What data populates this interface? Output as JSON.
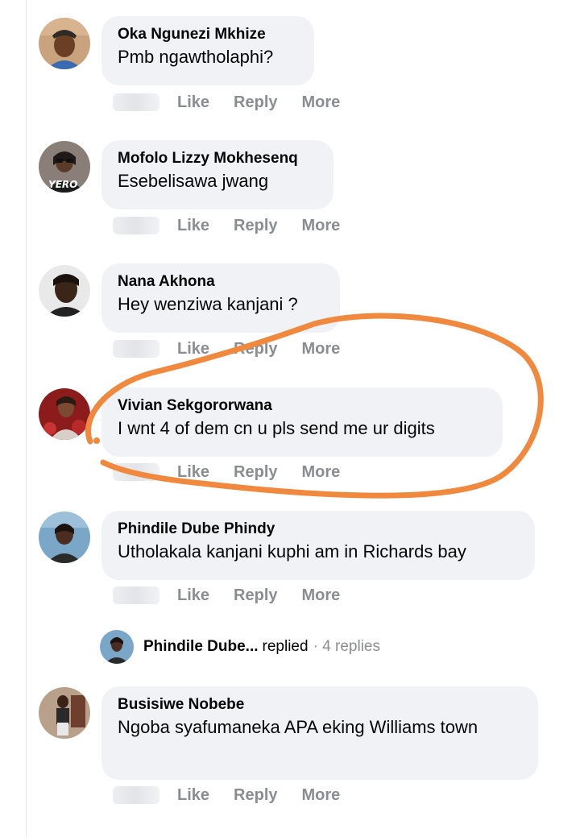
{
  "comments": [
    {
      "author": "Oka Ngunezi Mkhize",
      "text": "Pmb ngawtholaphi?",
      "actions": {
        "like": "Like",
        "reply": "Reply",
        "more": "More"
      }
    },
    {
      "author": "Mofolo Lizzy Mokhesenq",
      "text": "Esebelisawa jwang",
      "avatar_text": "YERO",
      "actions": {
        "like": "Like",
        "reply": "Reply",
        "more": "More"
      }
    },
    {
      "author": "Nana Akhona",
      "text": "Hey wenziwa kanjani ?",
      "actions": {
        "like": "Like",
        "reply": "Reply",
        "more": "More"
      }
    },
    {
      "author": "Vivian Sekgororwana",
      "text": "I wnt 4 of dem cn u pls send me ur digits",
      "actions": {
        "like": "Like",
        "reply": "Reply",
        "more": "More"
      }
    },
    {
      "author": "Phindile Dube Phindy",
      "text": "Utholakala kanjani kuphi am in Richards bay",
      "actions": {
        "like": "Like",
        "reply": "Reply",
        "more": "More"
      }
    },
    {
      "author": "Busisiwe Nobebe",
      "text": "Ngoba syafumaneka APA eking Williams town",
      "actions": {
        "like": "Like",
        "reply": "Reply",
        "more": "More"
      }
    }
  ],
  "reply_summary": {
    "name": "Phindile Dube...",
    "verb": "replied",
    "count": "· 4 replies"
  },
  "colors": {
    "bubble": "#f0f2f5",
    "action_text": "#8a8d91",
    "annotation": "#f0883e"
  }
}
